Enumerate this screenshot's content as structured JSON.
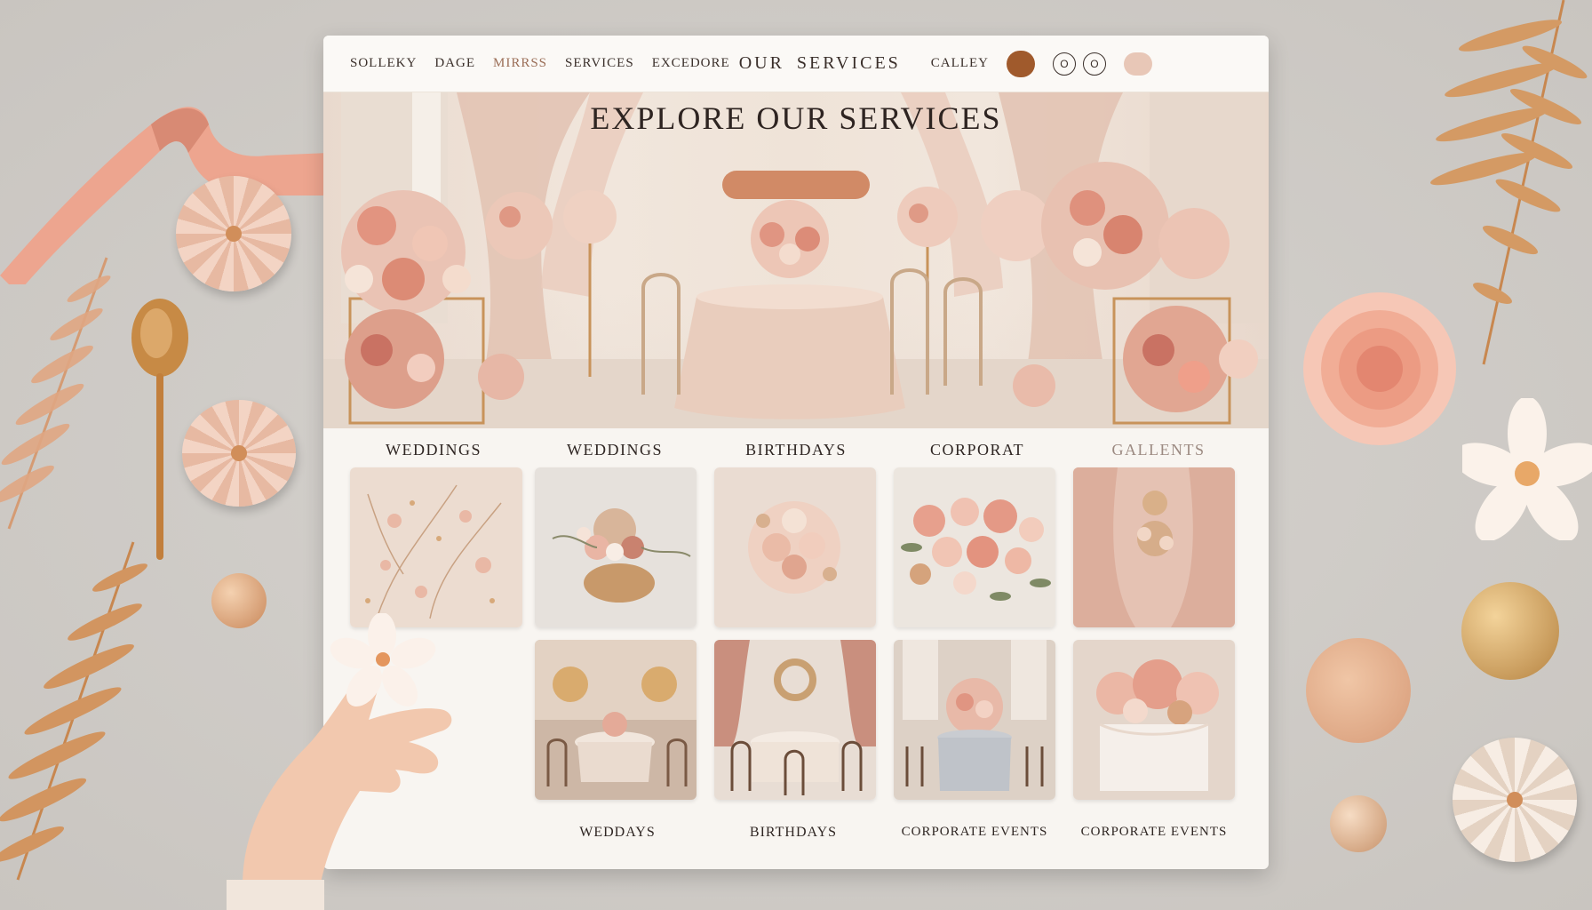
{
  "nav": {
    "items": [
      "SOLLEKY",
      "DAGE",
      "MIRRSS",
      "SERVICES",
      "EXCEDORE",
      "OUR",
      "SERVICES",
      "CALLEY"
    ],
    "pill_label": "",
    "circle_1": "O",
    "circle_2": "O",
    "pill_light_label": ""
  },
  "hero": {
    "title": "EXPLORE OUR SERVICES",
    "subtitle": "",
    "cta_label": ""
  },
  "categories": [
    "WEDDINGS",
    "WEDDINGS",
    "BIRTHDAYS",
    "CORPORAT",
    "GALLENTS"
  ],
  "bottom_labels": [
    "WEDDAYS",
    "BIRTHDAYS",
    "CORPORATE EVENTS",
    "CORPORATE EVENTS"
  ],
  "tiles": [
    {
      "name": "tile-floral-wall",
      "theme": "blush-floral"
    },
    {
      "name": "tile-table-centerpiece",
      "theme": "centerpiece"
    },
    {
      "name": "tile-bouquet",
      "theme": "bouquet"
    },
    {
      "name": "tile-rose-arrangement",
      "theme": "roses"
    },
    {
      "name": "tile-curtain-florals",
      "theme": "curtain"
    },
    {
      "name": "tile-banquet-hall",
      "theme": "banquet"
    },
    {
      "name": "tile-birthday-tables",
      "theme": "birthday"
    },
    {
      "name": "tile-corporate-table",
      "theme": "corporate"
    },
    {
      "name": "tile-floral-table",
      "theme": "floral-table"
    }
  ],
  "colors": {
    "accent": "#a05a2c",
    "cta": "#d18a66",
    "blush": "#e8c7b7",
    "background": "#cfcbc6"
  }
}
